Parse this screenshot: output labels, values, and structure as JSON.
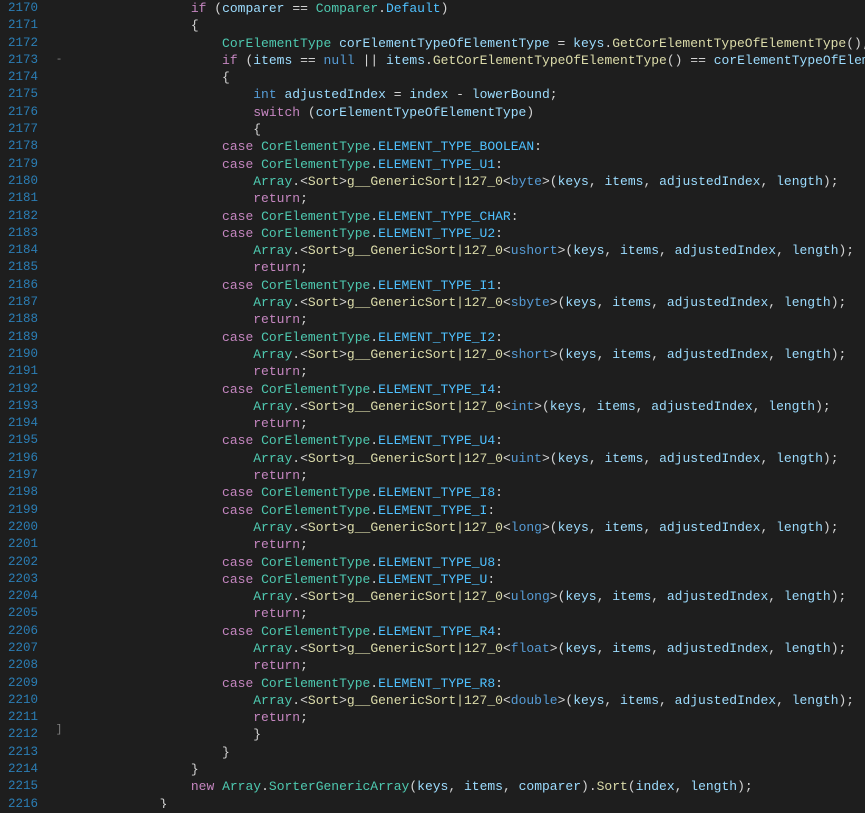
{
  "lineStart": 2170,
  "lineEnd": 2216,
  "foldMarks": {
    "2173": "-",
    "2212": "]"
  },
  "tokens": {
    "if": "if",
    "switch": "switch",
    "case": "case",
    "return": "return",
    "new": "new",
    "null": "null",
    "int": "int",
    "comparer": "comparer",
    "items": "items",
    "keys": "keys",
    "index": "index",
    "lowerBound": "lowerBound",
    "adjustedIndex": "adjustedIndex",
    "length": "length",
    "corVar": "corElementTypeOfElementType",
    "Comparer": "Comparer",
    "Default": "Default",
    "CorElementType": "CorElementType",
    "GetCor": "GetCorElementTypeOfElementType",
    "Array": "Array",
    "Sort": "Sort",
    "gGeneric": "g__GenericSort|127_0",
    "SorterGenericArray": "SorterGenericArray",
    "byte": "byte",
    "ushort": "ushort",
    "sbyte": "sbyte",
    "short": "short",
    "intT": "int",
    "uint": "uint",
    "long": "long",
    "ulong": "ulong",
    "float": "float",
    "double": "double",
    "BOOLEAN": "ELEMENT_TYPE_BOOLEAN",
    "U1": "ELEMENT_TYPE_U1",
    "CHAR": "ELEMENT_TYPE_CHAR",
    "U2": "ELEMENT_TYPE_U2",
    "I1": "ELEMENT_TYPE_I1",
    "I2": "ELEMENT_TYPE_I2",
    "I4": "ELEMENT_TYPE_I4",
    "U4": "ELEMENT_TYPE_U4",
    "I8": "ELEMENT_TYPE_I8",
    "I": "ELEMENT_TYPE_I",
    "U8": "ELEMENT_TYPE_U8",
    "U": "ELEMENT_TYPE_U",
    "R4": "ELEMENT_TYPE_R4",
    "R8": "ELEMENT_TYPE_R8"
  },
  "indent": {
    "i4": "                ",
    "i5": "                    ",
    "i6": "                        ",
    "i3": "            "
  }
}
